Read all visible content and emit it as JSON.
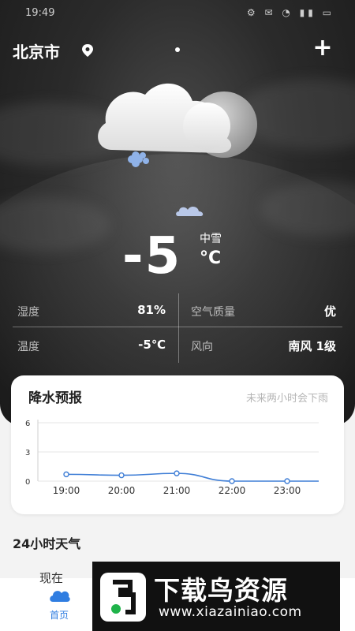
{
  "status_bar": {
    "time": "19:49",
    "icons": "⚙ ✉ ◔ ▮▮ ▭"
  },
  "header": {
    "city": "北京市"
  },
  "current": {
    "temperature": "-5",
    "condition": "中雪",
    "unit": "°C"
  },
  "stats": [
    {
      "label": "湿度",
      "value": "81%"
    },
    {
      "label": "空气质量",
      "value": "优"
    },
    {
      "label": "温度",
      "value": "-5℃"
    },
    {
      "label": "风向",
      "value": "南风  1级"
    }
  ],
  "precip_card": {
    "title": "降水预报",
    "hint": "未来两小时会下雨"
  },
  "chart_data": {
    "type": "line",
    "x": [
      "19:00",
      "20:00",
      "21:00",
      "22:00",
      "23:00"
    ],
    "series": [
      {
        "values": [
          0.7,
          0.6,
          0.8,
          0.0,
          0.0
        ]
      }
    ],
    "yticks": [
      "6",
      "3",
      "0"
    ],
    "ylim": [
      0,
      6
    ],
    "grid": true,
    "color": "#3f7ed6"
  },
  "section": {
    "title": "24小时天气",
    "now_label": "现在"
  },
  "tabbar": {
    "home_label": "首页"
  },
  "banner": {
    "title": "下载鸟资源",
    "url": "www.xiazainiao.com"
  },
  "colors": {
    "accent": "#2f7de1",
    "hero_bg": "#2b2b2b"
  }
}
